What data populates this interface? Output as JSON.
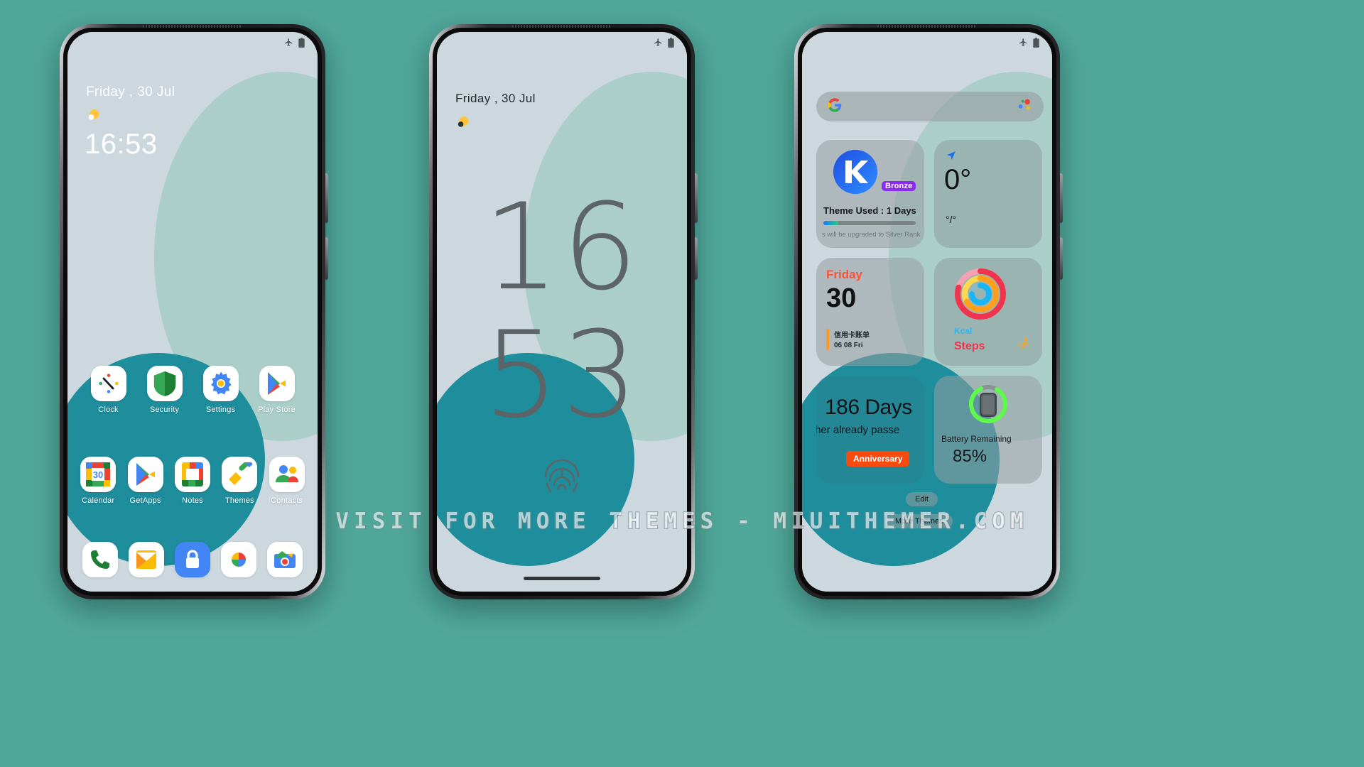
{
  "meta": {
    "background_color": "#4fa79a",
    "wallpaper_base": "#ccd8de",
    "wallpaper_mint": "#a9cdc6",
    "wallpaper_teal": "#1e8d9c",
    "watermark": "VISIT  FOR  MORE  THEMES  -  MIUITHEMER.COM"
  },
  "statusbar": {
    "airplane_icon": "airplane-icon",
    "battery_icon": "battery-icon"
  },
  "phone1": {
    "lock": {
      "date": "Friday , 30 Jul",
      "weather_icon": "sun-cloud-icon",
      "time": "16:53"
    },
    "apps_row1": [
      {
        "label": "Clock",
        "icon": "clock-app-icon"
      },
      {
        "label": "Security",
        "icon": "security-shield-icon"
      },
      {
        "label": "Settings",
        "icon": "settings-gear-icon"
      },
      {
        "label": "Play Store",
        "icon": "play-store-icon"
      }
    ],
    "apps_row2": [
      {
        "label": "Calendar",
        "icon": "calendar-app-icon",
        "day": "30"
      },
      {
        "label": "GetApps",
        "icon": "getapps-icon"
      },
      {
        "label": "Notes",
        "icon": "notes-app-icon"
      },
      {
        "label": "Themes",
        "icon": "themes-brush-icon"
      },
      {
        "label": "Contacts",
        "icon": "contacts-app-icon"
      }
    ],
    "dock": [
      {
        "label": "Phone",
        "icon": "phone-dialer-icon"
      },
      {
        "label": "Messages",
        "icon": "messages-icon"
      },
      {
        "label": "Security2",
        "icon": "lock-icon"
      },
      {
        "label": "Photos",
        "icon": "google-photos-icon"
      },
      {
        "label": "Camera",
        "icon": "camera-icon"
      }
    ]
  },
  "phone2": {
    "date": "Friday , 30 Jul",
    "weather_icon": "sun-cloud-icon",
    "hours": "16",
    "minutes": "53",
    "fingerprint_icon": "fingerprint-icon"
  },
  "phone3": {
    "search": {
      "google_icon": "google-g-icon",
      "assistant_icon": "google-assistant-icon",
      "placeholder": ""
    },
    "theme_widget": {
      "app_icon": "kika-k-icon",
      "badge": "Bronze",
      "badge_color": "#8b2bf0",
      "title": "Theme Used : 1 Days",
      "progress_percent": 16,
      "footnote": "s will be upgraded to Silver Rank"
    },
    "weather_widget": {
      "location_icon": "location-arrow-icon",
      "temperature": "0°",
      "range": "°/°"
    },
    "calendar_widget": {
      "weekday": "Friday",
      "day": "30",
      "event_title": "信用卡账单",
      "event_date": "06 08 Fri"
    },
    "steps_widget": {
      "ring_icon": "activity-rings-icon",
      "kcal_label": "Kcal",
      "steps_label": "Steps",
      "runner_icon": "runner-icon"
    },
    "anniversary_widget": {
      "days": "186 Days",
      "subtitle": "her already passe",
      "pill": "Anniversary",
      "pill_color": "#f74b10"
    },
    "battery_widget": {
      "phone_icon": "phone-outline-icon",
      "ring_color": "#5efa4b",
      "label": "Battery Remaining",
      "value": "85%",
      "percent": 85
    },
    "edit_button": "Edit",
    "more_themes_button": "More Themes"
  }
}
